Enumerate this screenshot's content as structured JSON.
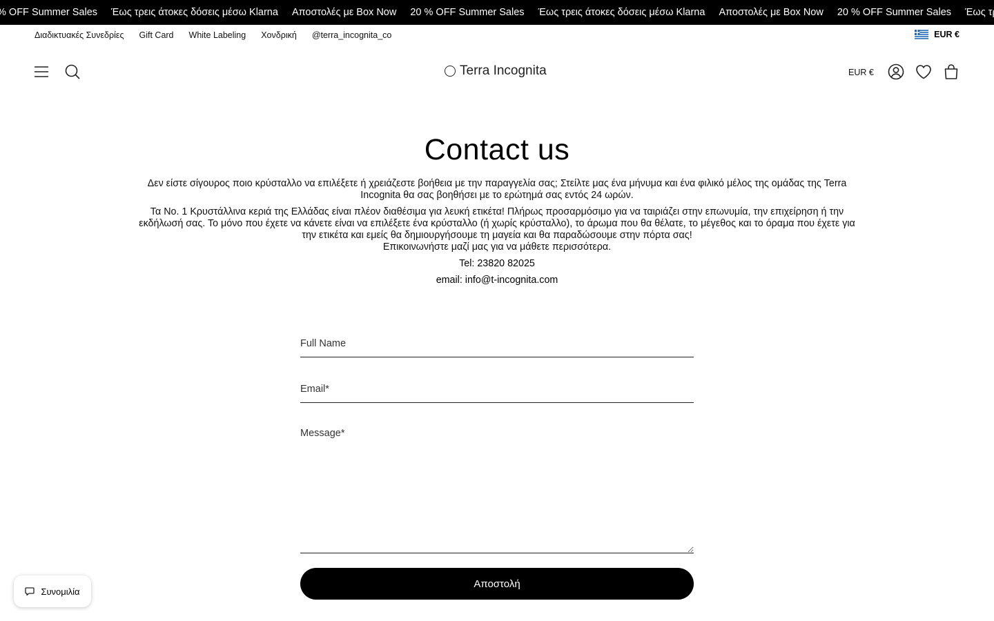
{
  "announcement": {
    "items": [
      "% OFF Summer Sales",
      "Έως τρεις άτοκες δόσεις μέσω Klarna",
      "Αποστολές με Box Now",
      "20 % OFF Summer Sales",
      "Έως τρεις άτοκες δόσεις μέσω Klarna",
      "Αποστολές με Box Now",
      "20 % OFF Summer Sales",
      "Έως τρεις άτοκες"
    ]
  },
  "utility": {
    "links": [
      "Διαδικτυακές Συνεδρίες",
      "Gift Card",
      "White Labeling",
      "Χονδρική",
      "@terra_incognita_co"
    ],
    "locale": "EUR €"
  },
  "header": {
    "logo_text": "Terra Incognita",
    "currency": "EUR €",
    "icons": [
      "menu-icon",
      "search-icon",
      "account-icon",
      "wishlist-icon",
      "cart-icon"
    ]
  },
  "page": {
    "title": "Contact us",
    "intro_1": "Δεν είστε σίγουρος ποιο κρύσταλλο να επιλέξετε ή χρειάζεστε βοήθεια με την παραγγελία σας; Στείλτε μας ένα μήνυμα και ένα φιλικό μέλος της ομάδας της Terra Incognita θα σας βοηθήσει με το ερώτημά σας εντός 24 ωρών.",
    "intro_2": "Τα  No. 1 Κρυστάλλινα κεριά της Ελλάδας είναι πλέον διαθέσιμα για λευκή ετικέτα! Πλήρως προσαρμόσιμο για να ταιριάζει στην επωνυμία, την επιχείρηση ή την εκδήλωσή σας. Το μόνο που έχετε να κάνετε είναι να επιλέξετε ένα κρύσταλλο (ή χωρίς κρύσταλλο), το άρωμα που θα θέλατε, το μέγεθος και το όραμα που έχετε για την ετικέτα και εμείς θα δημιουργήσουμε τη μαγεία και θα παραδώσουμε στην πόρτα σας!",
    "intro_3": "Επικοινωνήστε μαζί μας για να μάθετε περισσότερα.",
    "tel": "Tel: 23820 82025",
    "email": "email: info@t-incognita.com"
  },
  "form": {
    "name_placeholder": "Full Name",
    "email_placeholder": "Email*",
    "message_placeholder": "Message*",
    "name_value": "",
    "email_value": "",
    "message_value": "",
    "submit_label": "Αποστολή"
  },
  "chat": {
    "label": "Συνομιλία"
  },
  "colors": {
    "announcement_bg": "#000000",
    "text": "#000000",
    "button_bg": "#000000",
    "flag_blue": "#0D5EAF"
  }
}
